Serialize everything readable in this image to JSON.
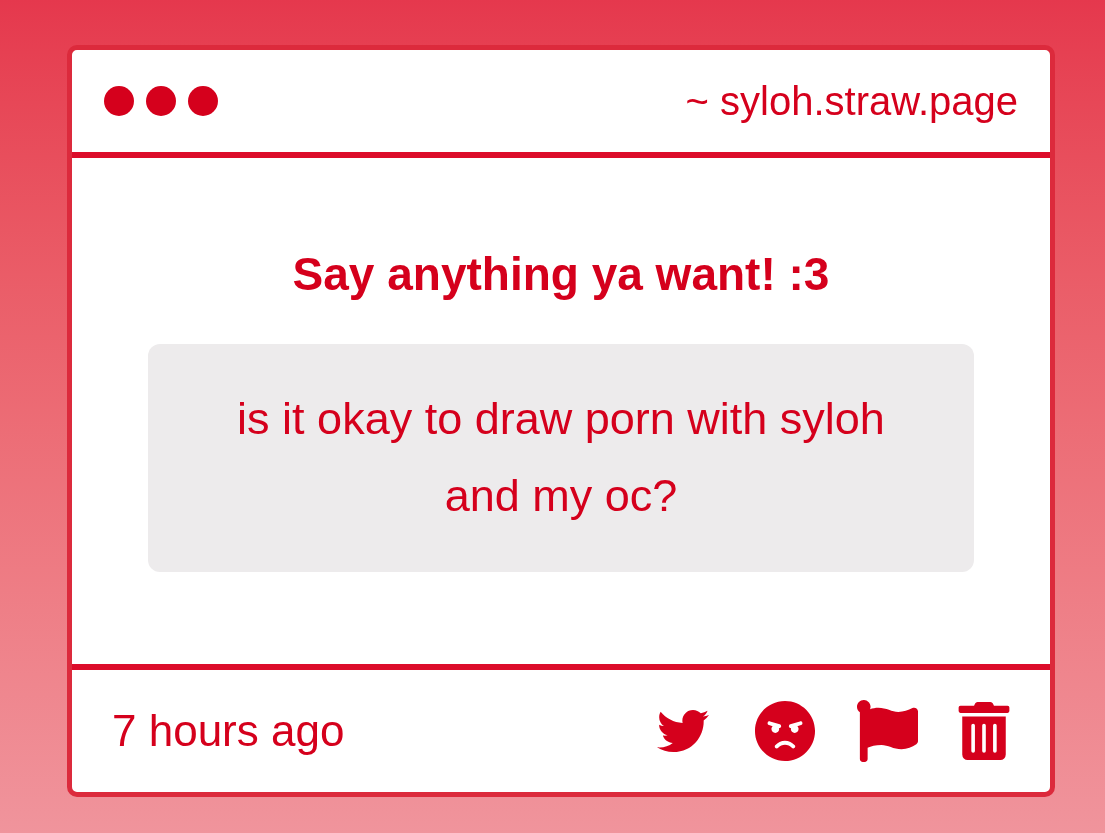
{
  "header": {
    "address": "~ syloh.straw.page"
  },
  "prompt": "Say anything ya want! :3",
  "message": "is it okay to draw porn with syloh and my oc?",
  "footer": {
    "time": "7 hours ago"
  }
}
